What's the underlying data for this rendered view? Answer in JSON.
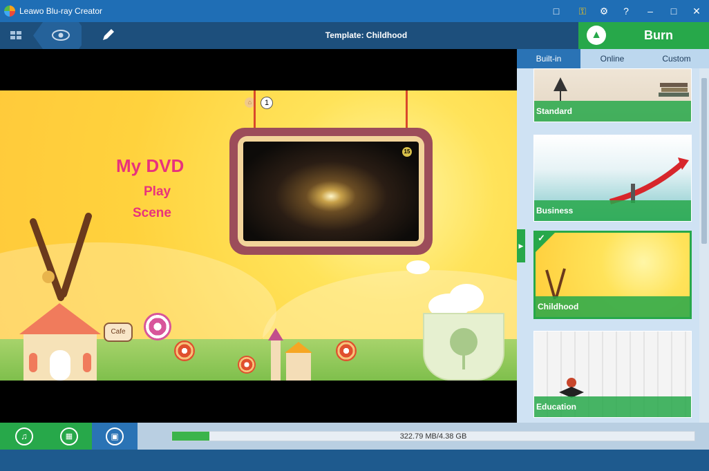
{
  "window": {
    "title": "Leawo Blu-ray Creator"
  },
  "titlebar_buttons": [
    "chat-icon",
    "key-icon",
    "gear-icon",
    "help-icon",
    "minimize-icon",
    "maximize-icon",
    "close-icon"
  ],
  "toolbar": {
    "template_label": "Template: Childhood",
    "burn_label": "Burn"
  },
  "menu": {
    "title": "My DVD",
    "play": "Play",
    "scene": "Scene",
    "page_number": "1",
    "video_chapter": "15",
    "cafe_sign": "Cafe"
  },
  "sidebar": {
    "tabs": [
      {
        "label": "Built-in",
        "active": true
      },
      {
        "label": "Online",
        "active": false
      },
      {
        "label": "Custom",
        "active": false
      }
    ],
    "templates": [
      {
        "label": "Standard",
        "selected": false
      },
      {
        "label": "Business",
        "selected": false
      },
      {
        "label": "Childhood",
        "selected": true
      },
      {
        "label": "Education",
        "selected": false
      }
    ]
  },
  "storage": {
    "used_text": "322.79 MB/4.38 GB",
    "used_fraction": 0.072
  },
  "colors": {
    "accent_green": "#27a84a",
    "title_blue": "#1f6eb5",
    "menu_pink": "#e8327c"
  }
}
